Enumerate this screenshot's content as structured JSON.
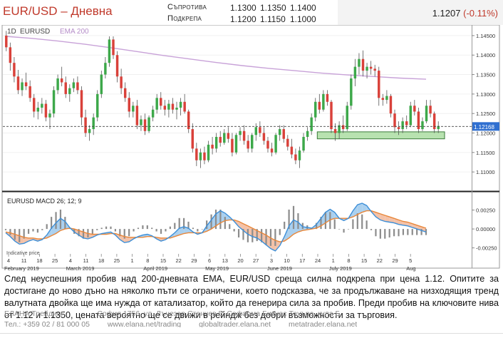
{
  "header": {
    "title": "EUR/USD – Дневна",
    "resistance_label": "Съпротива",
    "support_label": "Подкрепа",
    "resistance_levels": [
      "1.1300",
      "1.1350",
      "1.1400"
    ],
    "support_levels": [
      "1.1200",
      "1.1150",
      "1.1000"
    ],
    "last_price": "1.1207",
    "change": "(-0.11%)"
  },
  "colors": {
    "up": "#3da84a",
    "down": "#d9413a",
    "ema": "#c8a2d8",
    "macd_line": "#3d8fd8",
    "signal_line": "#e8873a",
    "macd_fill": "#aad0ef",
    "signal_fill": "#f4c2a8",
    "zone": "#b8e2b0"
  },
  "chart_data": [
    {
      "type": "candlestick",
      "title": "",
      "labels": {
        "timeframe": "1D",
        "symbol": "EURUSD",
        "indicator": "EMA 200"
      },
      "ylim": [
        1.106,
        1.147
      ],
      "y_ticks": [
        "1.11000",
        "1.11500",
        "1.12000",
        "1.12500",
        "1.13000",
        "1.13500",
        "1.14000",
        "1.14500"
      ],
      "last_price_tag": "1.12168",
      "last_price_level": 1.12168,
      "support_zone": [
        1.1185,
        1.1203
      ],
      "ema_200": [
        1.1448,
        1.1443,
        1.1436,
        1.1428,
        1.1419,
        1.1409,
        1.1399,
        1.139,
        1.1381,
        1.1373,
        1.1366,
        1.136,
        1.1354,
        1.1349,
        1.1345,
        1.1341,
        1.1338
      ],
      "x_tick_labels": [
        "4",
        "11",
        "18",
        "25",
        "4",
        "11",
        "18",
        "25",
        "1",
        "8",
        "15",
        "22",
        "29",
        "6",
        "13",
        "20",
        "27",
        "3",
        "10",
        "17",
        "24",
        "1",
        "8",
        "15",
        "22",
        "29",
        "5"
      ],
      "month_labels": [
        "February 2019",
        "March 2019",
        "April 2019",
        "May 2019",
        "June 2019",
        "July 2019",
        "Aug"
      ],
      "candles": [
        {
          "o": 1.145,
          "h": 1.1462,
          "l": 1.141,
          "c": 1.142
        },
        {
          "o": 1.142,
          "h": 1.1432,
          "l": 1.136,
          "c": 1.138
        },
        {
          "o": 1.138,
          "h": 1.1395,
          "l": 1.133,
          "c": 1.1345
        },
        {
          "o": 1.1345,
          "h": 1.1362,
          "l": 1.13,
          "c": 1.131
        },
        {
          "o": 1.131,
          "h": 1.134,
          "l": 1.1295,
          "c": 1.133
        },
        {
          "o": 1.133,
          "h": 1.1355,
          "l": 1.131,
          "c": 1.132
        },
        {
          "o": 1.132,
          "h": 1.1335,
          "l": 1.128,
          "c": 1.129
        },
        {
          "o": 1.129,
          "h": 1.13,
          "l": 1.124,
          "c": 1.1255
        },
        {
          "o": 1.1255,
          "h": 1.128,
          "l": 1.1235,
          "c": 1.1265
        },
        {
          "o": 1.1265,
          "h": 1.129,
          "l": 1.125,
          "c": 1.1275
        },
        {
          "o": 1.1275,
          "h": 1.1285,
          "l": 1.123,
          "c": 1.124
        },
        {
          "o": 1.124,
          "h": 1.126,
          "l": 1.121,
          "c": 1.125
        },
        {
          "o": 1.125,
          "h": 1.132,
          "l": 1.124,
          "c": 1.131
        },
        {
          "o": 1.131,
          "h": 1.135,
          "l": 1.13,
          "c": 1.134
        },
        {
          "o": 1.134,
          "h": 1.137,
          "l": 1.132,
          "c": 1.133
        },
        {
          "o": 1.133,
          "h": 1.1345,
          "l": 1.129,
          "c": 1.13
        },
        {
          "o": 1.13,
          "h": 1.1325,
          "l": 1.128,
          "c": 1.1315
        },
        {
          "o": 1.1315,
          "h": 1.134,
          "l": 1.1305,
          "c": 1.133
        },
        {
          "o": 1.133,
          "h": 1.1345,
          "l": 1.13,
          "c": 1.131
        },
        {
          "o": 1.131,
          "h": 1.132,
          "l": 1.122,
          "c": 1.124
        },
        {
          "o": 1.124,
          "h": 1.126,
          "l": 1.119,
          "c": 1.12
        },
        {
          "o": 1.12,
          "h": 1.122,
          "l": 1.118,
          "c": 1.121
        },
        {
          "o": 1.121,
          "h": 1.125,
          "l": 1.1195,
          "c": 1.124
        },
        {
          "o": 1.124,
          "h": 1.131,
          "l": 1.123,
          "c": 1.13
        },
        {
          "o": 1.13,
          "h": 1.136,
          "l": 1.129,
          "c": 1.135
        },
        {
          "o": 1.135,
          "h": 1.1395,
          "l": 1.134,
          "c": 1.138
        },
        {
          "o": 1.138,
          "h": 1.1448,
          "l": 1.137,
          "c": 1.144
        },
        {
          "o": 1.144,
          "h": 1.1448,
          "l": 1.139,
          "c": 1.14
        },
        {
          "o": 1.14,
          "h": 1.141,
          "l": 1.133,
          "c": 1.1345
        },
        {
          "o": 1.1345,
          "h": 1.1365,
          "l": 1.13,
          "c": 1.1315
        },
        {
          "o": 1.1315,
          "h": 1.133,
          "l": 1.128,
          "c": 1.129
        },
        {
          "o": 1.129,
          "h": 1.1305,
          "l": 1.124,
          "c": 1.1255
        },
        {
          "o": 1.1255,
          "h": 1.128,
          "l": 1.124,
          "c": 1.127
        },
        {
          "o": 1.127,
          "h": 1.1285,
          "l": 1.121,
          "c": 1.122
        },
        {
          "o": 1.122,
          "h": 1.1245,
          "l": 1.1205,
          "c": 1.1235
        },
        {
          "o": 1.1235,
          "h": 1.125,
          "l": 1.1195,
          "c": 1.1205
        },
        {
          "o": 1.1205,
          "h": 1.1245,
          "l": 1.12,
          "c": 1.124
        },
        {
          "o": 1.124,
          "h": 1.127,
          "l": 1.123,
          "c": 1.126
        },
        {
          "o": 1.126,
          "h": 1.13,
          "l": 1.125,
          "c": 1.129
        },
        {
          "o": 1.129,
          "h": 1.1305,
          "l": 1.126,
          "c": 1.127
        },
        {
          "o": 1.127,
          "h": 1.1285,
          "l": 1.1245,
          "c": 1.126
        },
        {
          "o": 1.126,
          "h": 1.1285,
          "l": 1.124,
          "c": 1.1275
        },
        {
          "o": 1.1275,
          "h": 1.129,
          "l": 1.125,
          "c": 1.126
        },
        {
          "o": 1.126,
          "h": 1.128,
          "l": 1.1235,
          "c": 1.1265
        },
        {
          "o": 1.1265,
          "h": 1.129,
          "l": 1.1245,
          "c": 1.128
        },
        {
          "o": 1.128,
          "h": 1.13,
          "l": 1.125,
          "c": 1.1255
        },
        {
          "o": 1.1255,
          "h": 1.126,
          "l": 1.12,
          "c": 1.121
        },
        {
          "o": 1.121,
          "h": 1.1225,
          "l": 1.115,
          "c": 1.116
        },
        {
          "o": 1.116,
          "h": 1.1175,
          "l": 1.1115,
          "c": 1.113
        },
        {
          "o": 1.113,
          "h": 1.116,
          "l": 1.111,
          "c": 1.115
        },
        {
          "o": 1.115,
          "h": 1.1165,
          "l": 1.112,
          "c": 1.113
        },
        {
          "o": 1.113,
          "h": 1.118,
          "l": 1.1125,
          "c": 1.117
        },
        {
          "o": 1.117,
          "h": 1.119,
          "l": 1.1145,
          "c": 1.116
        },
        {
          "o": 1.116,
          "h": 1.12,
          "l": 1.115,
          "c": 1.119
        },
        {
          "o": 1.119,
          "h": 1.1205,
          "l": 1.1165,
          "c": 1.1175
        },
        {
          "o": 1.1175,
          "h": 1.121,
          "l": 1.117,
          "c": 1.12
        },
        {
          "o": 1.12,
          "h": 1.1215,
          "l": 1.1175,
          "c": 1.1185
        },
        {
          "o": 1.1185,
          "h": 1.12,
          "l": 1.114,
          "c": 1.115
        },
        {
          "o": 1.115,
          "h": 1.12,
          "l": 1.1145,
          "c": 1.1195
        },
        {
          "o": 1.1195,
          "h": 1.1215,
          "l": 1.118,
          "c": 1.1205
        },
        {
          "o": 1.1205,
          "h": 1.122,
          "l": 1.117,
          "c": 1.118
        },
        {
          "o": 1.118,
          "h": 1.1195,
          "l": 1.115,
          "c": 1.116
        },
        {
          "o": 1.116,
          "h": 1.12,
          "l": 1.115,
          "c": 1.1195
        },
        {
          "o": 1.1195,
          "h": 1.1225,
          "l": 1.118,
          "c": 1.1215
        },
        {
          "o": 1.1215,
          "h": 1.123,
          "l": 1.119,
          "c": 1.12
        },
        {
          "o": 1.12,
          "h": 1.1215,
          "l": 1.117,
          "c": 1.118
        },
        {
          "o": 1.118,
          "h": 1.119,
          "l": 1.115,
          "c": 1.116
        },
        {
          "o": 1.116,
          "h": 1.1175,
          "l": 1.114,
          "c": 1.115
        },
        {
          "o": 1.115,
          "h": 1.12,
          "l": 1.1145,
          "c": 1.1195
        },
        {
          "o": 1.1195,
          "h": 1.122,
          "l": 1.118,
          "c": 1.121
        },
        {
          "o": 1.121,
          "h": 1.122,
          "l": 1.1175,
          "c": 1.1185
        },
        {
          "o": 1.1185,
          "h": 1.1195,
          "l": 1.1155,
          "c": 1.1165
        },
        {
          "o": 1.1165,
          "h": 1.1185,
          "l": 1.1135,
          "c": 1.1145
        },
        {
          "o": 1.1145,
          "h": 1.116,
          "l": 1.112,
          "c": 1.113
        },
        {
          "o": 1.113,
          "h": 1.1165,
          "l": 1.111,
          "c": 1.1155
        },
        {
          "o": 1.1155,
          "h": 1.12,
          "l": 1.115,
          "c": 1.119
        },
        {
          "o": 1.119,
          "h": 1.1215,
          "l": 1.118,
          "c": 1.1205
        },
        {
          "o": 1.1205,
          "h": 1.125,
          "l": 1.1195,
          "c": 1.124
        },
        {
          "o": 1.124,
          "h": 1.129,
          "l": 1.123,
          "c": 1.128
        },
        {
          "o": 1.128,
          "h": 1.13,
          "l": 1.125,
          "c": 1.126
        },
        {
          "o": 1.126,
          "h": 1.131,
          "l": 1.1255,
          "c": 1.13
        },
        {
          "o": 1.13,
          "h": 1.131,
          "l": 1.127,
          "c": 1.128
        },
        {
          "o": 1.128,
          "h": 1.1285,
          "l": 1.12,
          "c": 1.121
        },
        {
          "o": 1.121,
          "h": 1.1225,
          "l": 1.118,
          "c": 1.12
        },
        {
          "o": 1.12,
          "h": 1.123,
          "l": 1.1185,
          "c": 1.122
        },
        {
          "o": 1.122,
          "h": 1.1245,
          "l": 1.12,
          "c": 1.121
        },
        {
          "o": 1.121,
          "h": 1.128,
          "l": 1.1205,
          "c": 1.127
        },
        {
          "o": 1.127,
          "h": 1.135,
          "l": 1.126,
          "c": 1.134
        },
        {
          "o": 1.134,
          "h": 1.139,
          "l": 1.132,
          "c": 1.137
        },
        {
          "o": 1.137,
          "h": 1.1405,
          "l": 1.135,
          "c": 1.139
        },
        {
          "o": 1.139,
          "h": 1.1412,
          "l": 1.1345,
          "c": 1.136
        },
        {
          "o": 1.136,
          "h": 1.138,
          "l": 1.134,
          "c": 1.137
        },
        {
          "o": 1.137,
          "h": 1.1385,
          "l": 1.135,
          "c": 1.1365
        },
        {
          "o": 1.1365,
          "h": 1.1375,
          "l": 1.1345,
          "c": 1.136
        },
        {
          "o": 1.136,
          "h": 1.137,
          "l": 1.127,
          "c": 1.129
        },
        {
          "o": 1.129,
          "h": 1.13,
          "l": 1.127,
          "c": 1.1285
        },
        {
          "o": 1.1285,
          "h": 1.131,
          "l": 1.1275,
          "c": 1.1295
        },
        {
          "o": 1.1295,
          "h": 1.13,
          "l": 1.124,
          "c": 1.125
        },
        {
          "o": 1.125,
          "h": 1.126,
          "l": 1.12,
          "c": 1.1215
        },
        {
          "o": 1.1215,
          "h": 1.123,
          "l": 1.1195,
          "c": 1.121
        },
        {
          "o": 1.121,
          "h": 1.124,
          "l": 1.12,
          "c": 1.123
        },
        {
          "o": 1.123,
          "h": 1.1245,
          "l": 1.121,
          "c": 1.122
        },
        {
          "o": 1.122,
          "h": 1.128,
          "l": 1.1215,
          "c": 1.127
        },
        {
          "o": 1.127,
          "h": 1.1285,
          "l": 1.1245,
          "c": 1.1255
        },
        {
          "o": 1.1255,
          "h": 1.1265,
          "l": 1.12,
          "c": 1.121
        },
        {
          "o": 1.121,
          "h": 1.124,
          "l": 1.1205,
          "c": 1.123
        },
        {
          "o": 1.123,
          "h": 1.1285,
          "l": 1.1225,
          "c": 1.127
        },
        {
          "o": 1.127,
          "h": 1.1285,
          "l": 1.124,
          "c": 1.125
        },
        {
          "o": 1.125,
          "h": 1.1255,
          "l": 1.12,
          "c": 1.121
        },
        {
          "o": 1.121,
          "h": 1.123,
          "l": 1.12,
          "c": 1.1218
        }
      ]
    },
    {
      "type": "line",
      "title": "",
      "label": "EURUSD MACD 26; 12; 9",
      "ylim": [
        -0.0031,
        0.0034
      ],
      "y_ticks": [
        "0.00250",
        "0.00000",
        "-0.00250"
      ],
      "histogram_note": "Indicative price",
      "series": [
        {
          "name": "",
          "role": "macd",
          "values": [
            -0.0005,
            -0.001,
            -0.0016,
            -0.002,
            -0.0019,
            -0.0016,
            -0.0014,
            -0.0016,
            -0.0014,
            -0.0008,
            0.0001,
            0.0008,
            0.0014,
            0.001,
            0.0002,
            -0.0004,
            -0.0008,
            -0.0012,
            -0.0013,
            -0.0011,
            -0.0008,
            -0.0006,
            -0.0005,
            -0.0004,
            -0.0008,
            -0.0014,
            -0.0018,
            -0.0017,
            -0.0013,
            -0.001,
            -0.0008,
            -0.0007,
            -0.0009,
            -0.0013,
            -0.0016,
            -0.0014,
            -0.001,
            -0.0005,
            0.0001,
            0.0003,
            0.0001,
            -0.0004,
            -0.0007,
            -0.0005,
            0.0004,
            0.0012,
            0.002,
            0.0024,
            0.0021,
            0.0016,
            0.001,
            0.0003,
            -0.0002,
            -0.0007,
            -0.001,
            -0.0012,
            -0.0016,
            -0.0021,
            -0.0026,
            -0.0029,
            -0.0022,
            -0.001,
            0.0004,
            0.0012,
            0.0009,
            0.0003,
            0.0002,
            0.0001,
            0.0006,
            0.0014,
            0.0022,
            0.0026,
            0.0022,
            0.0014,
            0.0011,
            0.0014,
            0.0024,
            0.0032,
            0.0034,
            0.0031,
            0.0023,
            0.0016,
            0.0012,
            0.001,
            0.0009,
            0.0008,
            0.0006,
            0.0005,
            0.0004,
            0.0002,
            0.0,
            -0.0002,
            -0.0004
          ]
        },
        {
          "name": "",
          "role": "signal",
          "values": [
            -0.0004,
            -0.0005,
            -0.0007,
            -0.0009,
            -0.0011,
            -0.0012,
            -0.0012,
            -0.0013,
            -0.0013,
            -0.0012,
            -0.0009,
            -0.0006,
            -0.0002,
            0.0,
            0.0001,
            0.0,
            -0.0002,
            -0.0004,
            -0.0006,
            -0.0007,
            -0.0007,
            -0.0007,
            -0.0007,
            -0.0006,
            -0.0006,
            -0.0008,
            -0.001,
            -0.0011,
            -0.0011,
            -0.0011,
            -0.0011,
            -0.001,
            -0.001,
            -0.0011,
            -0.0012,
            -0.0012,
            -0.0012,
            -0.001,
            -0.0008,
            -0.0006,
            -0.0005,
            -0.0005,
            -0.0005,
            -0.0005,
            -0.0003,
            0.0,
            0.0004,
            0.0008,
            0.0011,
            0.0012,
            0.0012,
            0.001,
            0.0007,
            0.0004,
            0.0001,
            -0.0002,
            -0.0005,
            -0.0008,
            -0.0012,
            -0.0015,
            -0.0017,
            -0.0016,
            -0.0012,
            -0.0007,
            -0.0004,
            -0.0002,
            -0.0001,
            0.0,
            0.0001,
            0.0004,
            0.0008,
            0.0012,
            0.0014,
            0.0014,
            0.0014,
            0.0014,
            0.0016,
            0.0019,
            0.0022,
            0.0024,
            0.0024,
            0.0022,
            0.002,
            0.0018,
            0.0016,
            0.0014,
            0.0012,
            0.001,
            0.0009,
            0.0007,
            0.0005,
            0.0003,
            0.0001
          ]
        }
      ]
    }
  ],
  "comment": "След неуспешния пробив над 200-дневната ЕМА, EUR/USD среща силна подкрепа при цена 1.12. Опитите за достигане до ново дъно на няколко пъти се ограничени, което подсказва, че за продължаване на низходящия тренд валутната двойка ще има нужда от катализатор, който да генерира сила за пробив. Преди пробив на ключовите нива от 1.12 и 1.1350, цената вероятно ще се движи в рейндж без добри възможности за търговия.",
  "footer": {
    "company": "ЕЛАНА Трейдинг",
    "address": "София 1756, ул. Лъчезар Станчев 5, Софарма Бизнес Тауърс, кула Б",
    "phone": "Тел.: +359 02 / 81 000 05",
    "links": [
      "www.elana.net/trading",
      "globaltrader.elana.net",
      "metatrader.elana.net"
    ]
  }
}
